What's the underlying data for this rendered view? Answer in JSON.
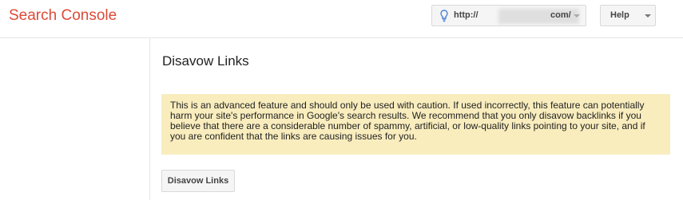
{
  "header": {
    "app_title": "Search Console",
    "site_selector": {
      "url_prefix": "http://",
      "url_suffix": "com/",
      "icon": "lightbulb-icon"
    },
    "help_label": "Help"
  },
  "main": {
    "page_title": "Disavow Links",
    "warning_text": "This is an advanced feature and should only be used with caution. If used incorrectly, this feature can potentially harm your site's performance in Google's search results. We recommend that you only disavow backlinks if you believe that there are a considerable number of spammy, artificial, or low-quality links pointing to your site, and if you are confident that the links are causing issues for you.",
    "disavow_button_label": "Disavow Links"
  },
  "colors": {
    "brand": "#dd4b39",
    "warning_background": "#f9edbe",
    "button_background": "#f5f5f5"
  }
}
